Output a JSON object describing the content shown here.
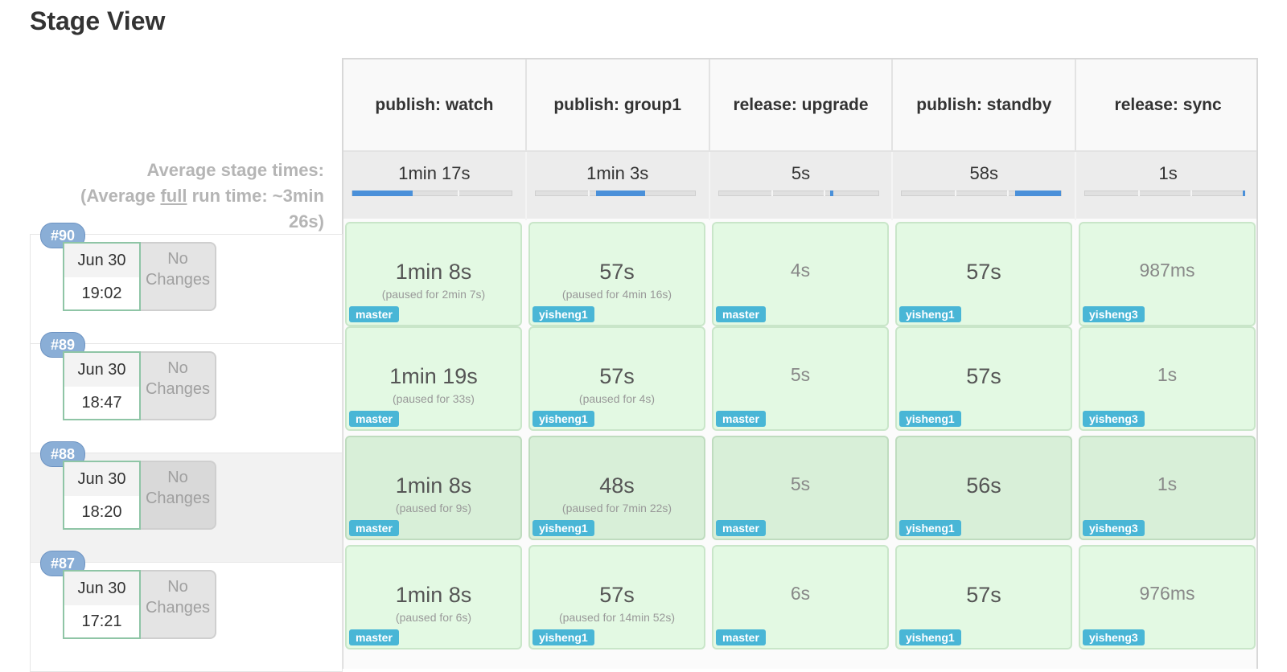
{
  "page": {
    "title": "Stage View"
  },
  "stages": [
    {
      "name": "publish: watch",
      "avg": "1min 17s",
      "bar_start": 0.0,
      "bar_fill": 0.38
    },
    {
      "name": "publish: group1",
      "avg": "1min 3s",
      "bar_start": 0.38,
      "bar_fill": 0.31
    },
    {
      "name": "release: upgrade",
      "avg": "5s",
      "bar_start": 0.7,
      "bar_fill": 0.02
    },
    {
      "name": "publish: standby",
      "avg": "58s",
      "bar_start": 0.71,
      "bar_fill": 0.29
    },
    {
      "name": "release: sync",
      "avg": "1s",
      "bar_start": 0.99,
      "bar_fill": 0.01
    }
  ],
  "average": {
    "line1": "Average stage times:",
    "line2_prefix": "(Average ",
    "line2_full": "full",
    "line2_suffix": " run time: ~3min",
    "line3": "26s)"
  },
  "builds": [
    {
      "number": "#90",
      "date": "Jun 30",
      "time": "19:02",
      "changes": "No Changes",
      "cells": [
        {
          "time": "1min 8s",
          "paused": "(paused for 2min 7s)",
          "branch": "master"
        },
        {
          "time": "57s",
          "paused": "(paused for 4min 16s)",
          "branch": "yisheng1"
        },
        {
          "time": "4s",
          "paused": "",
          "branch": "master"
        },
        {
          "time": "57s",
          "paused": "",
          "branch": "yisheng1"
        },
        {
          "time": "987ms",
          "paused": "",
          "branch": "yisheng3"
        }
      ]
    },
    {
      "number": "#89",
      "date": "Jun 30",
      "time": "18:47",
      "changes": "No Changes",
      "cells": [
        {
          "time": "1min 19s",
          "paused": "(paused for 33s)",
          "branch": "master"
        },
        {
          "time": "57s",
          "paused": "(paused for 4s)",
          "branch": "yisheng1"
        },
        {
          "time": "5s",
          "paused": "",
          "branch": "master"
        },
        {
          "time": "57s",
          "paused": "",
          "branch": "yisheng1"
        },
        {
          "time": "1s",
          "paused": "",
          "branch": "yisheng3"
        }
      ]
    },
    {
      "number": "#88",
      "date": "Jun 30",
      "time": "18:20",
      "changes": "No Changes",
      "cells": [
        {
          "time": "1min 8s",
          "paused": "(paused for 9s)",
          "branch": "master"
        },
        {
          "time": "48s",
          "paused": "(paused for 7min 22s)",
          "branch": "yisheng1"
        },
        {
          "time": "5s",
          "paused": "",
          "branch": "master"
        },
        {
          "time": "56s",
          "paused": "",
          "branch": "yisheng1"
        },
        {
          "time": "1s",
          "paused": "",
          "branch": "yisheng3"
        }
      ]
    },
    {
      "number": "#87",
      "date": "Jun 30",
      "time": "17:21",
      "changes": "No Changes",
      "cells": [
        {
          "time": "1min 8s",
          "paused": "(paused for 6s)",
          "branch": "master"
        },
        {
          "time": "57s",
          "paused": "(paused for 14min 52s)",
          "branch": "yisheng1"
        },
        {
          "time": "6s",
          "paused": "",
          "branch": "master"
        },
        {
          "time": "57s",
          "paused": "",
          "branch": "yisheng1"
        },
        {
          "time": "976ms",
          "paused": "",
          "branch": "yisheng3"
        }
      ]
    }
  ]
}
